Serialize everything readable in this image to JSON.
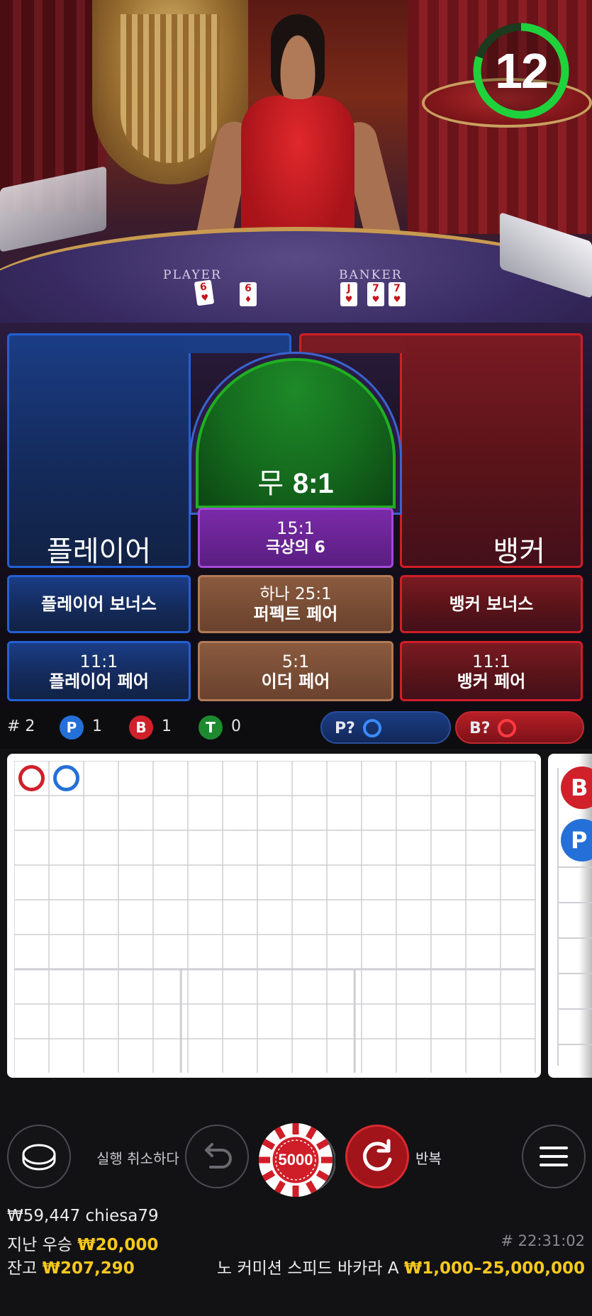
{
  "video": {
    "felt_player_label": "PLAYER",
    "felt_banker_label": "BANKER",
    "player_cards": [
      "6",
      "6"
    ],
    "banker_cards": [
      "J",
      "7",
      "7"
    ],
    "timer": "12",
    "timer_fraction": 0.8
  },
  "bets": {
    "player": "플레이어",
    "banker": "뱅커",
    "tie_label": "무",
    "tie_odds": "8:1",
    "super6_odds": "15:1",
    "super6_label": "극상의 6",
    "player_bonus": "플레이어 보너스",
    "banker_bonus": "뱅커 보너스",
    "perfect_pair_odds": "하나 25:1",
    "perfect_pair_label": "퍼펙트 페어",
    "player_pair_odds": "11:1",
    "player_pair_label": "플레이어 페어",
    "either_pair_odds": "5:1",
    "either_pair_label": "이더 페어",
    "banker_pair_odds": "11:1",
    "banker_pair_label": "뱅커 페어"
  },
  "stats": {
    "shoe": "# 2",
    "p_letter": "P",
    "p_count": "1",
    "b_letter": "B",
    "b_count": "1",
    "t_letter": "T",
    "t_count": "0",
    "player_ask": "P?",
    "banker_ask": "B?"
  },
  "roadmap": {
    "results": [
      "B",
      "P"
    ],
    "side_peek": [
      "B",
      "P"
    ]
  },
  "controls": {
    "undo_label": "실행 취소하다",
    "chip_value": "5000",
    "repeat_label": "반복"
  },
  "info": {
    "user_line": "₩59,447 chiesa79",
    "last_win_label": "지난 우승",
    "last_win_value": "₩20,000",
    "balance_label": "잔고",
    "balance_value": "₩207,290",
    "round_id": "# 22:31:02",
    "table_name": "노 커미션 스피드 바카라 A",
    "limits": "₩1,000–25,000,000"
  },
  "colors": {
    "player_blue": "#2470d8",
    "banker_red": "#d0202a",
    "tie_green": "#1e8a30",
    "gold": "#f6c81e",
    "timer_green": "#1fd23c"
  }
}
